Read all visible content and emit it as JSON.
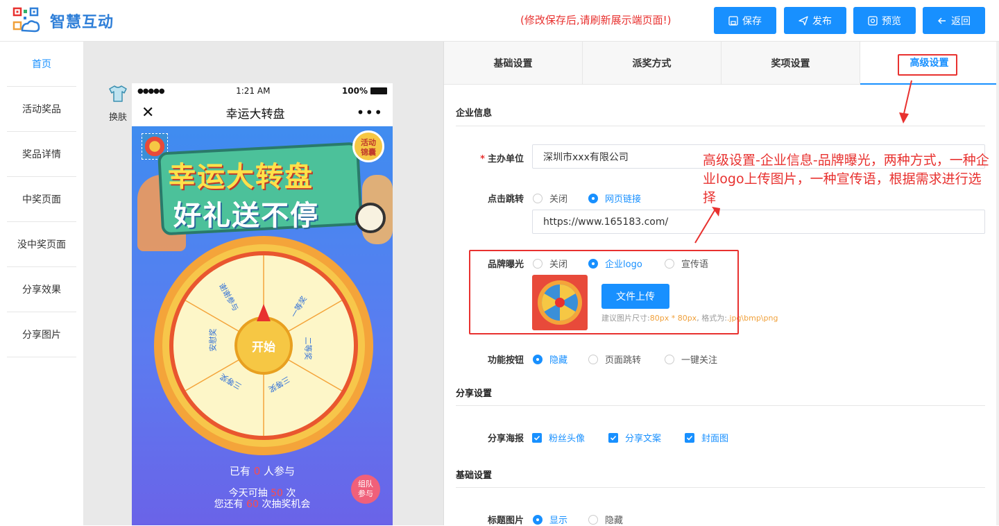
{
  "app": {
    "name": "智慧互动"
  },
  "header": {
    "notice": "(修改保存后,请刷新展示端页面!)",
    "buttons": [
      {
        "label": "保存",
        "icon": "save-icon"
      },
      {
        "label": "发布",
        "icon": "send-icon"
      },
      {
        "label": "预览",
        "icon": "preview-icon"
      },
      {
        "label": "返回",
        "icon": "arrow-left-icon"
      }
    ]
  },
  "sidebar": {
    "items": [
      {
        "label": "首页",
        "active": true
      },
      {
        "label": "活动奖品"
      },
      {
        "label": "奖品详情"
      },
      {
        "label": "中奖页面"
      },
      {
        "label": "没中奖页面"
      },
      {
        "label": "分享效果"
      },
      {
        "label": "分享图片"
      }
    ]
  },
  "preview": {
    "skin_label": "换肤",
    "status": {
      "signal": "●●●●●",
      "time": "1:21 AM",
      "battery": "100%"
    },
    "page_title": "幸运大转盘",
    "banner_line1": "幸运大转盘",
    "banner_line2": "好礼送不停",
    "badge_activity": "活动锦囊",
    "wheel": {
      "start": "开始",
      "segments": [
        "谢谢参与",
        "一等奖",
        "二等奖",
        "三等奖",
        "三等奖",
        "安慰奖"
      ]
    },
    "participants_pre": "已有",
    "participants_count": "0",
    "participants_post": "人参与",
    "today_pre": "今天可抽",
    "today_count": "50",
    "today_post": "次",
    "remain_pre": "您还有",
    "remain_count": "60",
    "remain_post": "次抽奖机会",
    "team_badge": "组队参与"
  },
  "tabs": [
    {
      "label": "基础设置"
    },
    {
      "label": "派奖方式"
    },
    {
      "label": "奖项设置"
    },
    {
      "label": "高级设置",
      "active": true
    }
  ],
  "form": {
    "section_company": "企业信息",
    "host_label": "主办单位",
    "host_value": "深圳市xxx有限公司",
    "click_label": "点击跳转",
    "click_options": [
      "关闭",
      "网页链接"
    ],
    "click_selected": 1,
    "url_value": "https://www.165183.com/",
    "brand_label": "品牌曝光",
    "brand_options": [
      "关闭",
      "企业logo",
      "宣传语"
    ],
    "brand_selected": 1,
    "upload_label": "文件上传",
    "hint_pre": "建议图片尺寸:",
    "hint_size": "80px * 80px",
    "hint_mid": ", 格式为:",
    "hint_format": ".jpg\\bmp\\png",
    "func_label": "功能按钮",
    "func_options": [
      "隐藏",
      "页面跳转",
      "一键关注"
    ],
    "func_selected": 0,
    "section_share": "分享设置",
    "poster_label": "分享海报",
    "poster_options": [
      "粉丝头像",
      "分享文案",
      "封面图"
    ],
    "section_basic": "基础设置",
    "title_img_label": "标题图片",
    "title_img_options": [
      "显示",
      "隐藏"
    ],
    "title_img_selected": 0
  },
  "annotation": {
    "text": "高级设置-企业信息-品牌曝光，两种方式，一种企业logo上传图片，一种宣传语，根据需求进行选择"
  },
  "colors": {
    "primary": "#1890ff",
    "alert": "#e8312f",
    "orange": "#f0a03a"
  }
}
